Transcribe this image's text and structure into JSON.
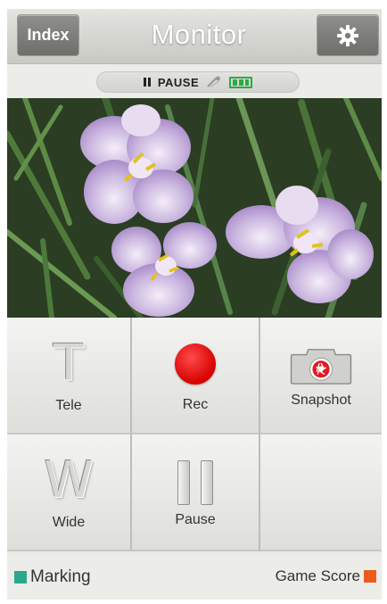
{
  "header": {
    "index_label": "Index",
    "title": "Monitor",
    "settings_icon": "gear-icon"
  },
  "status": {
    "text": "PAUSE",
    "pause_icon": "pause-icon",
    "link_icon": "wireless-link-icon",
    "battery_icon": "battery-icon",
    "battery_color": "#2eaa44"
  },
  "controls": {
    "tele_label": "Tele",
    "tele_glyph": "T",
    "rec_label": "Rec",
    "rec_color": "#e00000",
    "snapshot_label": "Snapshot",
    "snapshot_icon": "camera-icon",
    "wide_label": "Wide",
    "wide_glyph": "W",
    "pause_label": "Pause",
    "pause_icon": "pause-icon"
  },
  "bottom": {
    "marking_label": "Marking",
    "marking_color": "#2aa88a",
    "game_score_label": "Game Score",
    "game_score_color": "#ec5a1e"
  }
}
